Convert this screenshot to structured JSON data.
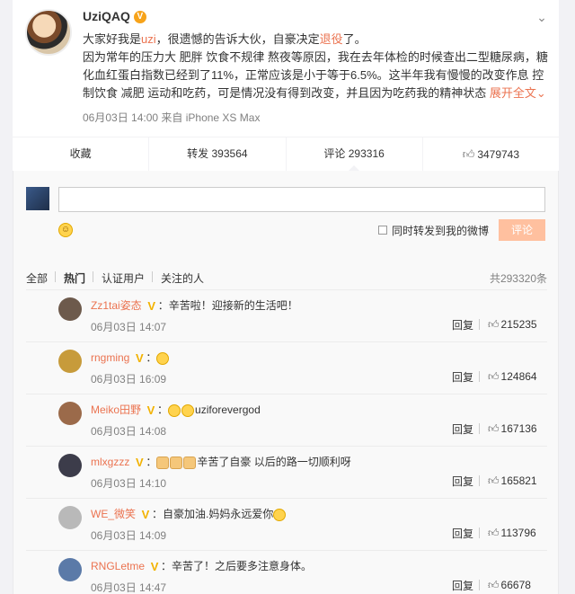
{
  "post": {
    "username": "UziQAQ",
    "text_prefix": "大家好我是",
    "mention": "uzi",
    "text_mid": "，很遗憾的告诉大伙，自豪决定",
    "hashtag": "退役",
    "text_end": "了。",
    "body": "因为常年的压力大 肥胖 饮食不规律 熬夜等原因，我在去年体检的时候查出二型糖尿病，糖化血红蛋白指数已经到了11%，正常应该是小于等于6.5%。这半年我有慢慢的改变作息 控制饮食 减肥 运动和吃药，可是情况没有得到改变，并且因为吃药我的精神状态",
    "expand": "展开全文",
    "meta": "06月03日 14:00  来自 iPhone XS Max"
  },
  "actions": {
    "favorite": "收藏",
    "repost": "转发 393564",
    "comment": "评论 293316",
    "like": "3479743"
  },
  "composer": {
    "repost_label": "同时转发到我的微博",
    "submit": "评论"
  },
  "tabs": {
    "all": "全部",
    "hot": "热门",
    "verified": "认证用户",
    "following": "关注的人",
    "count": "共293320条"
  },
  "comments": [
    {
      "name": "Zz1tai姿态",
      "badge": "V",
      "text": "：辛苦啦！迎接新的生活吧！",
      "time": "06月03日 14:07",
      "likes": "215235",
      "emoji": 0
    },
    {
      "name": "rngming",
      "badge": "V",
      "text": "：",
      "time": "06月03日 16:09",
      "likes": "124864",
      "emoji": 1
    },
    {
      "name": "Meiko田野",
      "badge": "V",
      "text": "：",
      "tail": "uziforevergod",
      "time": "06月03日 14:08",
      "likes": "167136",
      "emoji": 2
    },
    {
      "name": "mlxgzzz",
      "badge": "V",
      "text": "：",
      "tail": "辛苦了自豪 以后的路一切顺利呀",
      "time": "06月03日 14:10",
      "likes": "165821",
      "emoji": 3
    },
    {
      "name": "WE_微笑",
      "badge": "V",
      "text": "：自豪加油.妈妈永远爱你",
      "time": "06月03日 14:09",
      "likes": "113796",
      "emoji": 1
    },
    {
      "name": "RNGLetme",
      "badge": "V",
      "text": "：辛苦了！之后要多注意身体。",
      "time": "06月03日 14:47",
      "likes": "66678",
      "emoji": 0
    }
  ],
  "reply_label": "回复",
  "colors": {
    "accent": "#eb7350",
    "vip": "#f7a31a"
  }
}
